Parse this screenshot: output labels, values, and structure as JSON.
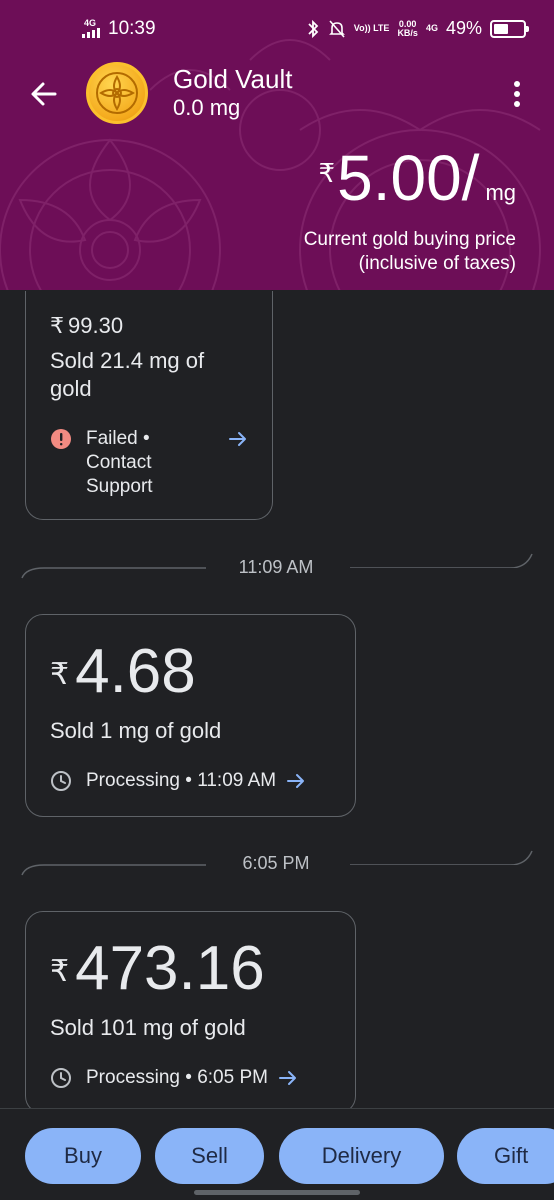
{
  "status_bar": {
    "network": "4G",
    "time": "10:39",
    "volte": "Vo)) LTE",
    "speed_value": "0.00",
    "speed_unit": "KB/s",
    "network2": "4G",
    "battery": "49%",
    "battery_level": 0.49
  },
  "header": {
    "title": "Gold Vault",
    "subtitle": "0.0 mg",
    "price_currency": "₹",
    "price_value": "5.00/",
    "price_unit": "mg",
    "price_caption_line1": "Current gold buying price",
    "price_caption_line2": "(inclusive of taxes)"
  },
  "transactions": [
    {
      "amount_currency": "₹",
      "amount": "99.30",
      "desc_line1": "Sold 21.4 mg of",
      "desc_line2": "gold",
      "status_line1": "Failed •",
      "status_line2": "Contact",
      "status_line3": "Support"
    },
    {
      "time_separator": "11:09 AM",
      "amount_currency": "₹",
      "amount": "4.68",
      "desc": "Sold 1 mg of gold",
      "status": "Processing • 11:09 AM"
    },
    {
      "time_separator": "6:05 PM",
      "amount_currency": "₹",
      "amount": "473.16",
      "desc": "Sold 101 mg of gold",
      "status": "Processing • 6:05 PM"
    }
  ],
  "actions": {
    "buy": "Buy",
    "sell": "Sell",
    "delivery": "Delivery",
    "gift": "Gift"
  },
  "colors": {
    "header_bg": "#6d0e57",
    "page_bg": "#202124",
    "accent_blue": "#8ab4f8",
    "error": "#f28b82"
  }
}
